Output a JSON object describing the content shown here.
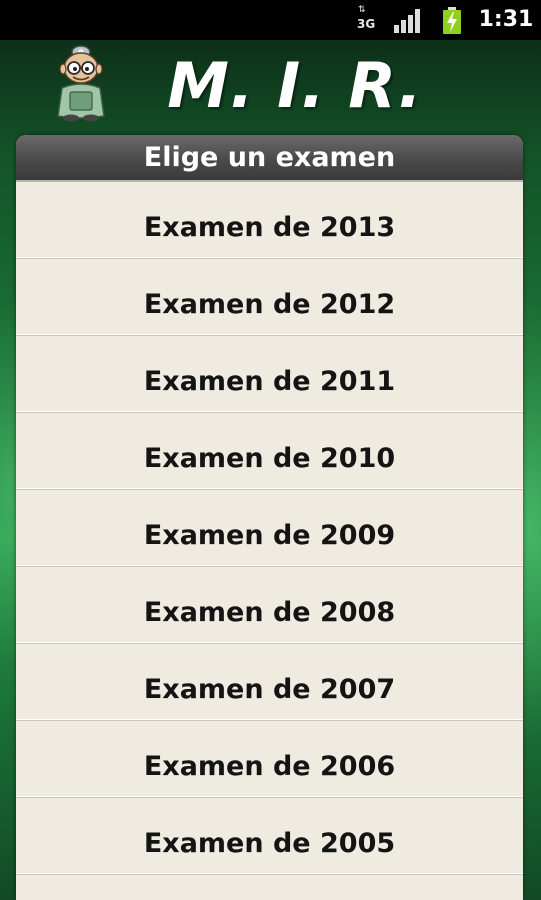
{
  "status_bar": {
    "network_type": "3G",
    "network_icon": "data-arrows-icon",
    "signal_icon": "signal-bars-icon",
    "battery_icon": "battery-charging-icon",
    "battery_color": "#8ecf1f",
    "time": "1:31"
  },
  "header": {
    "title": "M. I. R.",
    "mascot_icon": "doctor-mascot-icon"
  },
  "panel": {
    "title": "Elige un examen",
    "items": [
      {
        "label": "Examen de 2013"
      },
      {
        "label": "Examen de 2012"
      },
      {
        "label": "Examen de 2011"
      },
      {
        "label": "Examen de 2010"
      },
      {
        "label": "Examen de 2009"
      },
      {
        "label": "Examen de 2008"
      },
      {
        "label": "Examen de 2007"
      },
      {
        "label": "Examen de 2006"
      },
      {
        "label": "Examen de 2005"
      }
    ]
  },
  "colors": {
    "background_green": "#1d7a3a",
    "panel_background": "#efebe1",
    "panel_header": "#4a4a4a",
    "item_text": "#141414"
  }
}
